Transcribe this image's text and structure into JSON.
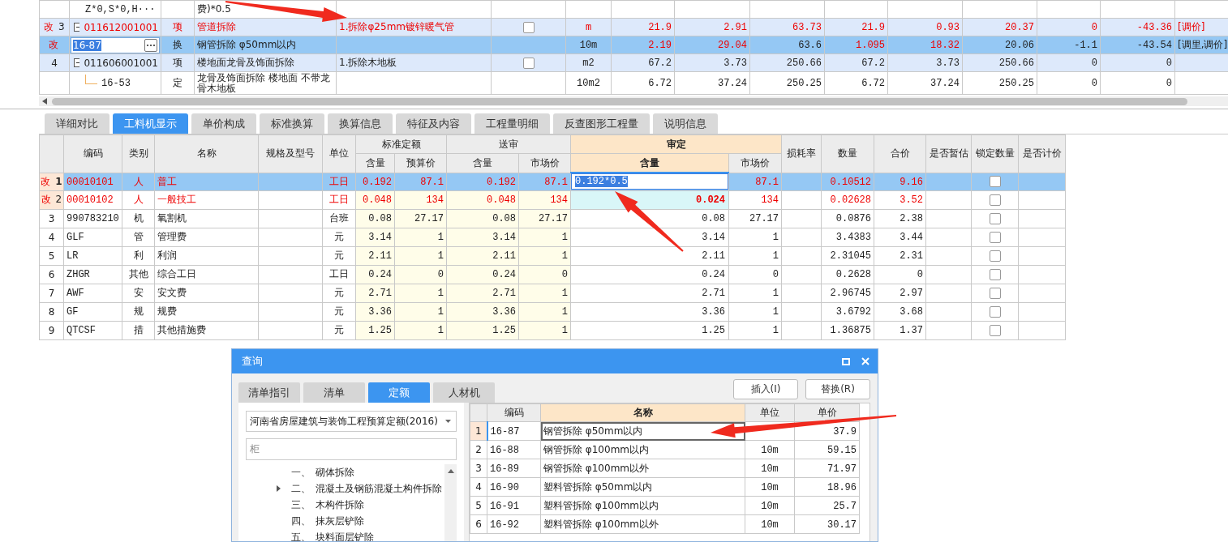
{
  "top_table": {
    "rows": [
      {
        "kind": "quota",
        "selected": false,
        "changed": false,
        "code": "Z*0,S*0,H···",
        "name": "费)*0.5",
        "values": []
      },
      {
        "kind": "item",
        "selected": false,
        "changed": true,
        "mark": "改",
        "index": "3",
        "expanded": true,
        "code": "011612001001",
        "type": "项",
        "name": "管道拆除",
        "feature": "1.拆除φ25mm镀锌暖气管",
        "checked": false,
        "unit": "m",
        "values": [
          {
            "value": "21.9",
            "changed": true
          },
          {
            "value": "2.91",
            "changed": true
          },
          {
            "value": "63.73",
            "changed": true
          },
          {
            "value": "21.9",
            "changed": true
          },
          {
            "value": "0.93",
            "changed": true
          },
          {
            "value": "20.37",
            "changed": true
          },
          {
            "value": "0",
            "changed": true
          },
          {
            "value": "-43.36",
            "changed": true
          }
        ],
        "note": "[调价]"
      },
      {
        "kind": "quota",
        "selected": true,
        "changed": false,
        "mark": "改",
        "code": "16-87",
        "editing": true,
        "type": "换",
        "name": "钢管拆除  φ50mm以内",
        "unit": "10m",
        "values": [
          {
            "value": "2.19",
            "changed": true
          },
          {
            "value": "29.04",
            "changed": true
          },
          {
            "value": "63.6",
            "changed": false
          },
          {
            "value": "1.095",
            "changed": true
          },
          {
            "value": "18.32",
            "changed": true
          },
          {
            "value": "20.06",
            "changed": false
          },
          {
            "value": "-1.1",
            "changed": false
          },
          {
            "value": "-43.54",
            "changed": false
          }
        ],
        "note": "[调里,调价]"
      },
      {
        "kind": "item",
        "selected": false,
        "changed": false,
        "index": "4",
        "expanded": true,
        "code": "011606001001",
        "type": "项",
        "name": "楼地面龙骨及饰面拆除",
        "feature": "1.拆除木地板",
        "checked": false,
        "unit": "m2",
        "values": [
          {
            "value": "67.2",
            "changed": false
          },
          {
            "value": "3.73",
            "changed": false
          },
          {
            "value": "250.66",
            "changed": false
          },
          {
            "value": "67.2",
            "changed": false
          },
          {
            "value": "3.73",
            "changed": false
          },
          {
            "value": "250.66",
            "changed": false
          },
          {
            "value": "0",
            "changed": false
          },
          {
            "value": "0",
            "changed": false
          }
        ]
      },
      {
        "kind": "quota",
        "selected": false,
        "changed": false,
        "code": "16-53",
        "editing": false,
        "type": "定",
        "name": "龙骨及饰面拆除 楼地面 不带龙骨木地板",
        "unit": "10m2",
        "values": [
          {
            "value": "6.72",
            "changed": false
          },
          {
            "value": "37.24",
            "changed": false
          },
          {
            "value": "250.25",
            "changed": false
          },
          {
            "value": "6.72",
            "changed": false
          },
          {
            "value": "37.24",
            "changed": false
          },
          {
            "value": "250.25",
            "changed": false
          },
          {
            "value": "0",
            "changed": false
          },
          {
            "value": "0",
            "changed": false
          }
        ]
      }
    ]
  },
  "detail_tabs": [
    {
      "label": "详细对比",
      "selected": false
    },
    {
      "label": "工料机显示",
      "selected": true
    },
    {
      "label": "单价构成",
      "selected": false
    },
    {
      "label": "标准换算",
      "selected": false
    },
    {
      "label": "换算信息",
      "selected": false
    },
    {
      "label": "特征及内容",
      "selected": false
    },
    {
      "label": "工程量明细",
      "selected": false
    },
    {
      "label": "反查图形工程量",
      "selected": false
    },
    {
      "label": "说明信息",
      "selected": false
    }
  ],
  "resource_table": {
    "header": [
      {
        "label": "编码",
        "active": false
      },
      {
        "label": "类别",
        "active": false
      },
      {
        "label": "名称",
        "active": false
      },
      {
        "label": "规格及型号",
        "active": false
      },
      {
        "label": "单位",
        "active": false
      },
      {
        "label": "标准定额",
        "active": false,
        "children": [
          {
            "label": "含量",
            "active": false
          },
          {
            "label": "预算价",
            "active": false
          }
        ]
      },
      {
        "label": "送审",
        "active": false,
        "children": [
          {
            "label": "含量",
            "active": false
          },
          {
            "label": "市场价",
            "active": false
          }
        ]
      },
      {
        "label": "审定",
        "active": true,
        "children": [
          {
            "label": "含量",
            "active": true
          },
          {
            "label": "市场价",
            "active": false
          }
        ]
      },
      {
        "label": "损耗率",
        "active": false
      },
      {
        "label": "数量",
        "active": false
      },
      {
        "label": "合价",
        "active": false
      },
      {
        "label": "是否暂估",
        "active": false
      },
      {
        "label": "锁定数量",
        "active": false
      },
      {
        "label": "是否计价",
        "active": false
      }
    ],
    "rows": [
      {
        "mark": "改",
        "index": "1",
        "code": "00010101",
        "type": "人",
        "name": "普工",
        "unit": "工日",
        "std_qty": "0.192",
        "std_price": "87.1",
        "sub_qty": "0.192",
        "sub_price": "87.1",
        "app_qty": "0.192*0.5",
        "app_price": "87.1",
        "quantity": "0.10512",
        "total": "9.16",
        "locked": false,
        "selected": true,
        "changed": true,
        "editing": true,
        "adjusted": false
      },
      {
        "mark": "改",
        "index": "2",
        "code": "00010102",
        "type": "人",
        "name": "一般技工",
        "unit": "工日",
        "std_qty": "0.048",
        "std_price": "134",
        "sub_qty": "0.048",
        "sub_price": "134",
        "app_qty": "0.024",
        "app_price": "134",
        "quantity": "0.02628",
        "total": "3.52",
        "locked": false,
        "selected": false,
        "changed": true,
        "editing": false,
        "adjusted": true
      },
      {
        "index": "3",
        "code": "990783210",
        "type": "机",
        "name": "氧割机",
        "unit": "台班",
        "std_qty": "0.08",
        "std_price": "27.17",
        "sub_qty": "0.08",
        "sub_price": "27.17",
        "app_qty": "0.08",
        "app_price": "27.17",
        "quantity": "0.0876",
        "total": "2.38",
        "locked": false,
        "selected": false,
        "changed": false,
        "editing": false,
        "adjusted": false
      },
      {
        "index": "4",
        "code": "GLF",
        "type": "管",
        "name": "管理费",
        "unit": "元",
        "std_qty": "3.14",
        "std_price": "1",
        "sub_qty": "3.14",
        "sub_price": "1",
        "app_qty": "3.14",
        "app_price": "1",
        "quantity": "3.4383",
        "total": "3.44",
        "locked": false,
        "selected": false,
        "changed": false,
        "editing": false,
        "adjusted": false
      },
      {
        "index": "5",
        "code": "LR",
        "type": "利",
        "name": "利润",
        "unit": "元",
        "std_qty": "2.11",
        "std_price": "1",
        "sub_qty": "2.11",
        "sub_price": "1",
        "app_qty": "2.11",
        "app_price": "1",
        "quantity": "2.31045",
        "total": "2.31",
        "locked": false,
        "selected": false,
        "changed": false,
        "editing": false,
        "adjusted": false
      },
      {
        "index": "6",
        "code": "ZHGR",
        "type": "其他",
        "name": "综合工日",
        "unit": "工日",
        "std_qty": "0.24",
        "std_price": "0",
        "sub_qty": "0.24",
        "sub_price": "0",
        "app_qty": "0.24",
        "app_price": "0",
        "quantity": "0.2628",
        "total": "0",
        "locked": false,
        "selected": false,
        "changed": false,
        "editing": false,
        "adjusted": false
      },
      {
        "index": "7",
        "code": "AWF",
        "type": "安",
        "name": "安文费",
        "unit": "元",
        "std_qty": "2.71",
        "std_price": "1",
        "sub_qty": "2.71",
        "sub_price": "1",
        "app_qty": "2.71",
        "app_price": "1",
        "quantity": "2.96745",
        "total": "2.97",
        "locked": false,
        "selected": false,
        "changed": false,
        "editing": false,
        "adjusted": false
      },
      {
        "index": "8",
        "code": "GF",
        "type": "规",
        "name": "规费",
        "unit": "元",
        "std_qty": "3.36",
        "std_price": "1",
        "sub_qty": "3.36",
        "sub_price": "1",
        "app_qty": "3.36",
        "app_price": "1",
        "quantity": "3.6792",
        "total": "3.68",
        "locked": false,
        "selected": false,
        "changed": false,
        "editing": false,
        "adjusted": false
      },
      {
        "index": "9",
        "code": "QTCSF",
        "type": "措",
        "name": "其他措施费",
        "unit": "元",
        "std_qty": "1.25",
        "std_price": "1",
        "sub_qty": "1.25",
        "sub_price": "1",
        "app_qty": "1.25",
        "app_price": "1",
        "quantity": "1.36875",
        "total": "1.37",
        "locked": false,
        "selected": false,
        "changed": false,
        "editing": false,
        "adjusted": false
      }
    ]
  },
  "query_dialog": {
    "title": "查询",
    "tabs": [
      {
        "label": "清单指引",
        "selected": false
      },
      {
        "label": "清单",
        "selected": false
      },
      {
        "label": "定额",
        "selected": true
      },
      {
        "label": "人材机",
        "selected": false
      }
    ],
    "buttons": [
      "插入(I)",
      "替换(R)"
    ],
    "library": "河南省房屋建筑与装饰工程预算定额(2016)",
    "search": "柜",
    "tree": [
      {
        "number": "一、",
        "label": "砌体拆除",
        "has_children": false
      },
      {
        "number": "二、",
        "label": "混凝土及钢筋混凝土构件拆除",
        "has_children": true
      },
      {
        "number": "三、",
        "label": "木构件拆除",
        "has_children": false
      },
      {
        "number": "四、",
        "label": "抹灰层铲除",
        "has_children": false
      },
      {
        "number": "五、",
        "label": "块料面层铲除",
        "has_children": false
      }
    ],
    "columns": [
      {
        "label": "编码",
        "active": false
      },
      {
        "label": "名称",
        "active": true
      },
      {
        "label": "单位",
        "active": false
      },
      {
        "label": "单价",
        "active": false
      }
    ],
    "rows": [
      {
        "index": "1",
        "code": "16-87",
        "name": "钢管拆除  φ50mm以内",
        "price": "37.9",
        "selected": true
      },
      {
        "index": "2",
        "code": "16-88",
        "name": "钢管拆除  φ100mm以内",
        "unit": "10m",
        "price": "59.15",
        "selected": false
      },
      {
        "index": "3",
        "code": "16-89",
        "name": "钢管拆除  φ100mm以外",
        "unit": "10m",
        "price": "71.97",
        "selected": false
      },
      {
        "index": "4",
        "code": "16-90",
        "name": "塑料管拆除  φ50mm以内",
        "unit": "10m",
        "price": "18.96",
        "selected": false
      },
      {
        "index": "5",
        "code": "16-91",
        "name": "塑料管拆除  φ100mm以内",
        "unit": "10m",
        "price": "25.7",
        "selected": false
      },
      {
        "index": "6",
        "code": "16-92",
        "name": "塑料管拆除  φ100mm以外",
        "unit": "10m",
        "price": "30.17",
        "selected": false
      }
    ]
  }
}
